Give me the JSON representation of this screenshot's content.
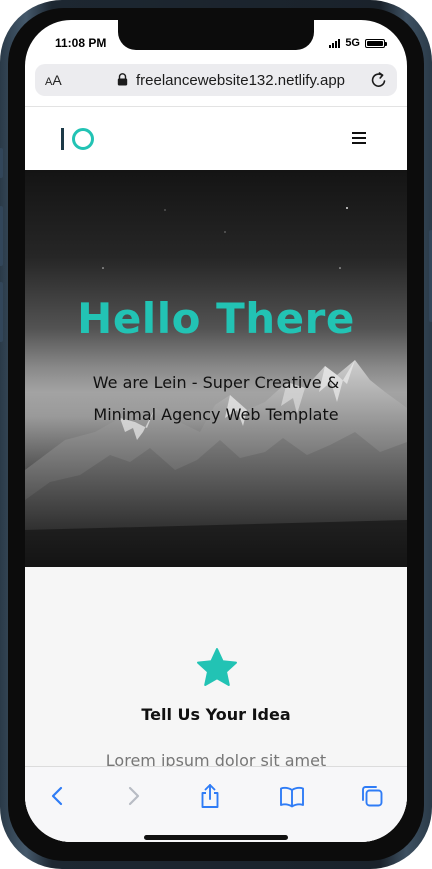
{
  "status_bar": {
    "time": "11:08 PM",
    "network": "5G"
  },
  "browser": {
    "aa_label_small": "A",
    "aa_label_large": "A",
    "url": "freelancewebsite132.netlify.app"
  },
  "site": {
    "logo_text": "IO",
    "hero": {
      "title": "Hello There",
      "subtitle_line1": "We are Lein - Super Creative &",
      "subtitle_line2": "Minimal Agency Web Template"
    },
    "feature": {
      "icon": "star-icon",
      "title": "Tell Us Your Idea",
      "text": "Lorem ipsum dolor sit amet"
    }
  },
  "toolbar": {
    "buttons": [
      "back-icon",
      "forward-icon",
      "share-icon",
      "bookmarks-icon",
      "tabs-icon"
    ]
  },
  "colors": {
    "accent": "#22c3b4",
    "logo_bar": "#1c3a47",
    "ios_blue": "#2f7cf6",
    "disabled_gray": "#b8bcc4"
  }
}
